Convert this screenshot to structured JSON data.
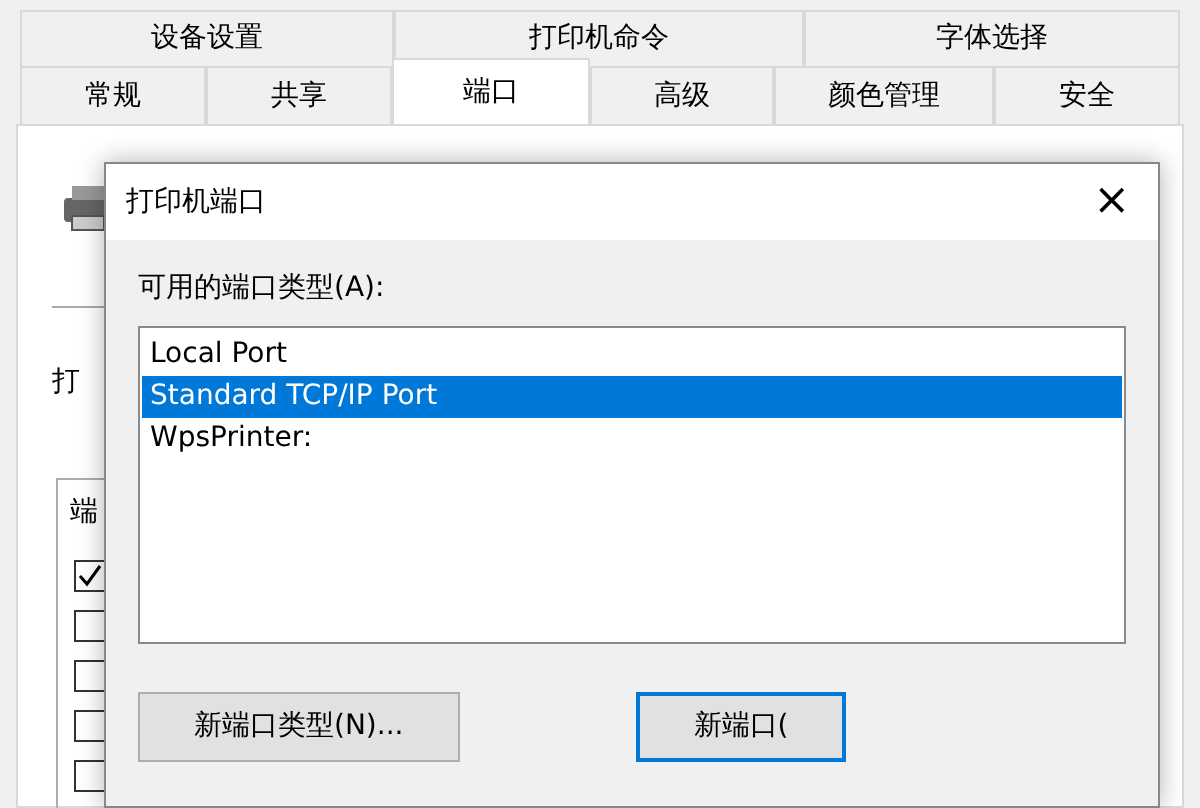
{
  "tab_rows": [
    [
      {
        "label": "设备设置",
        "selected": false
      },
      {
        "label": "打印机命令",
        "selected": false
      },
      {
        "label": "字体选择",
        "selected": false
      }
    ],
    [
      {
        "label": "常规",
        "selected": false
      },
      {
        "label": "共享",
        "selected": false
      },
      {
        "label": "端口",
        "selected": true
      },
      {
        "label": "高级",
        "selected": false
      },
      {
        "label": "颜色管理",
        "selected": false
      },
      {
        "label": "安全",
        "selected": false
      }
    ]
  ],
  "background_panel": {
    "label": "打",
    "group_label": "端",
    "checkboxes": [
      {
        "checked": true
      },
      {
        "checked": false
      },
      {
        "checked": false
      },
      {
        "checked": false
      },
      {
        "checked": false
      }
    ]
  },
  "dialog": {
    "title": "打印机端口",
    "close": "×",
    "list_label": "可用的端口类型(A):",
    "port_types": [
      {
        "label": "Local Port",
        "selected": false
      },
      {
        "label": "Standard TCP/IP Port",
        "selected": true
      },
      {
        "label": "WpsPrinter:",
        "selected": false
      }
    ],
    "buttons": [
      {
        "label": "新端口类型(N)...",
        "default": false
      },
      {
        "label": "新端口(",
        "default": true
      }
    ]
  }
}
